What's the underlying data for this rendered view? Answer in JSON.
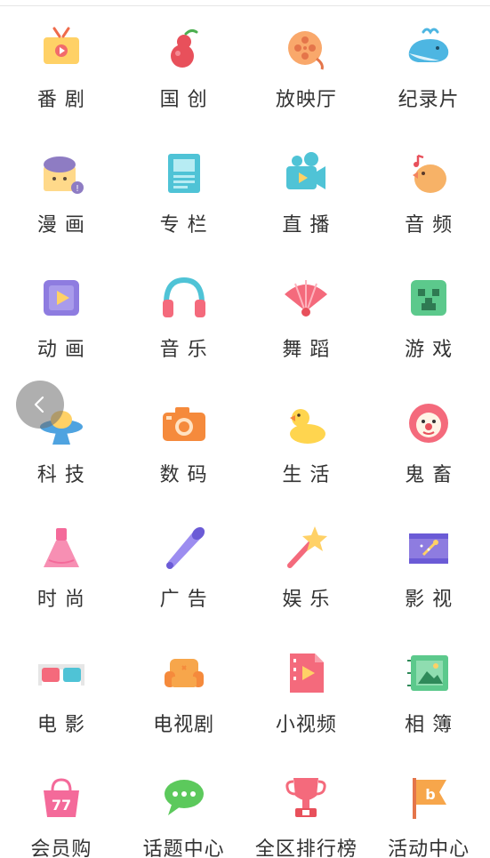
{
  "categories": [
    {
      "label": "番 剧",
      "icon": "tv-icon"
    },
    {
      "label": "国 创",
      "icon": "gourd-icon"
    },
    {
      "label": "放映厅",
      "icon": "film-reel-icon"
    },
    {
      "label": "纪录片",
      "icon": "whale-icon"
    },
    {
      "label": "漫 画",
      "icon": "comic-icon"
    },
    {
      "label": "专 栏",
      "icon": "article-icon"
    },
    {
      "label": "直 播",
      "icon": "live-camera-icon"
    },
    {
      "label": "音 频",
      "icon": "bird-music-icon"
    },
    {
      "label": "动 画",
      "icon": "animation-play-icon"
    },
    {
      "label": "音 乐",
      "icon": "headphones-icon"
    },
    {
      "label": "舞 蹈",
      "icon": "fan-icon"
    },
    {
      "label": "游 戏",
      "icon": "game-block-icon"
    },
    {
      "label": "科 技",
      "icon": "ufo-icon"
    },
    {
      "label": "数 码",
      "icon": "camera-icon"
    },
    {
      "label": "生 活",
      "icon": "duck-icon"
    },
    {
      "label": "鬼 畜",
      "icon": "clown-icon"
    },
    {
      "label": "时 尚",
      "icon": "dress-icon"
    },
    {
      "label": "广 告",
      "icon": "megaphone-icon"
    },
    {
      "label": "娱 乐",
      "icon": "star-wand-icon"
    },
    {
      "label": "影 视",
      "icon": "clapper-icon"
    },
    {
      "label": "电 影",
      "icon": "3d-glasses-icon"
    },
    {
      "label": "电视剧",
      "icon": "sofa-icon"
    },
    {
      "label": "小视频",
      "icon": "video-file-icon"
    },
    {
      "label": "相 簿",
      "icon": "photo-album-icon"
    },
    {
      "label": "会员购",
      "icon": "shopping-bag-icon"
    },
    {
      "label": "话题中心",
      "icon": "chat-bubble-icon"
    },
    {
      "label": "全区排行榜",
      "icon": "trophy-icon"
    },
    {
      "label": "活动中心",
      "icon": "flag-icon"
    }
  ],
  "colors": {
    "label_text": "#333333",
    "divider": "#e6e6e6"
  }
}
